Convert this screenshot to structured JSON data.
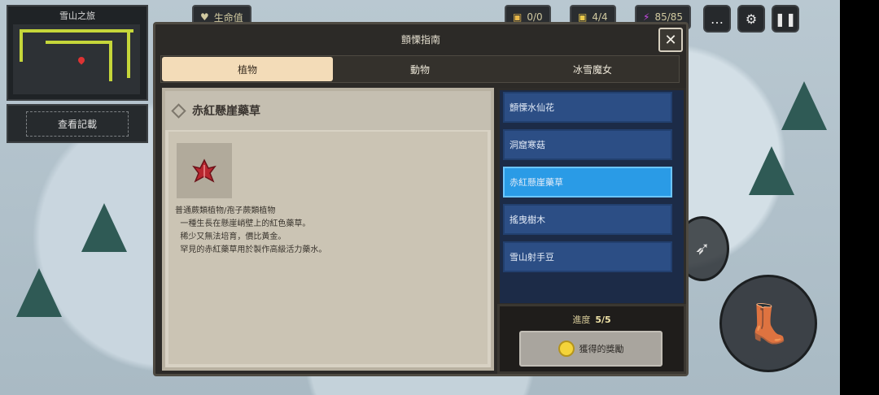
{
  "hud": {
    "minimap_title": "雪山之旅",
    "record_button": "查看記載",
    "hp_label": "生命值",
    "chips": [
      {
        "icon": "chest-icon",
        "text": "0/0",
        "color": "#e8b84a"
      },
      {
        "icon": "gold-box-icon",
        "text": "4/4",
        "color": "#e8c84a"
      },
      {
        "icon": "energy-icon",
        "text": "85/85",
        "color": "#c84ae8"
      }
    ]
  },
  "dialog": {
    "title": "顫慄指南",
    "close_glyph": "✕",
    "tabs": [
      {
        "label": "植物",
        "active": true
      },
      {
        "label": "動物",
        "active": false
      },
      {
        "label": "冰雪魔女",
        "active": false
      }
    ],
    "detail": {
      "name": "赤紅懸崖藥草",
      "description": [
        "普通蕨類植物/孢子蕨類植物",
        "  一種生長在懸崖峭壁上的紅色藥草。",
        "  稀少又無法培育，價比黃金。",
        "  罕見的赤紅藥草用於製作高級活力藥水。"
      ]
    },
    "list": [
      {
        "label": "顫慄水仙花",
        "selected": false
      },
      {
        "label": "洞窟寒菇",
        "selected": false
      },
      {
        "label": "赤紅懸崖藥草",
        "selected": true
      },
      {
        "label": "搖曳樹木",
        "selected": false
      },
      {
        "label": "雪山射手豆",
        "selected": false
      }
    ],
    "progress_label": "進度",
    "progress_value": "5/5",
    "reward_button": "獲得的獎勵"
  }
}
